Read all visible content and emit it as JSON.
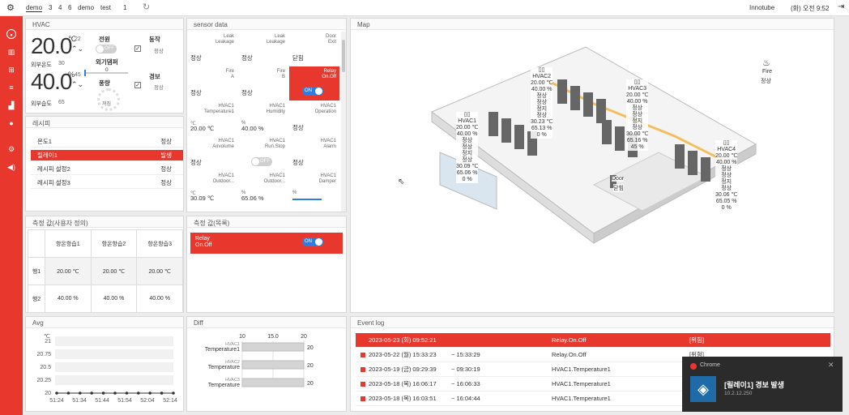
{
  "header": {
    "tabs": [
      "demo",
      "3",
      "4",
      "6",
      "demo",
      "test",
      "1"
    ],
    "brand": "Innotube",
    "clock": "(화) 오전 9:52"
  },
  "hvac": {
    "title": "HVAC",
    "temp": "20.0",
    "temp_unit": "℃",
    "temp_set": "22",
    "outdoor_temp_label": "외부온도",
    "outdoor_temp": "30",
    "humid": "40.0",
    "humid_unit": "%",
    "humid_set": "45",
    "outdoor_humid_label": "외부습도",
    "outdoor_humid": "65",
    "power_label": "전원",
    "power_state": "OFF",
    "run_label": "동작",
    "run_value": "정상",
    "damper_label": "외기댐퍼",
    "damper_value": "0",
    "airflow_label": "풍량",
    "airflow_value": "꺼짐",
    "alarm_label": "경보",
    "alarm_value": "정상"
  },
  "recipe": {
    "title": "레시피",
    "items": [
      {
        "name": "온도1",
        "status": "정상",
        "active": false
      },
      {
        "name": "릴레이1",
        "status": "발생",
        "active": true
      },
      {
        "name": "레시피 설정2",
        "status": "정상",
        "active": false
      },
      {
        "name": "레시피 설정3",
        "status": "정상",
        "active": false
      }
    ]
  },
  "sensor": {
    "title": "sensor data",
    "cells": [
      {
        "t1": "Leak",
        "t2": "Leakage",
        "v": "정상"
      },
      {
        "t1": "Leak",
        "t2": "Leakage",
        "v": "정상"
      },
      {
        "t1": "Door",
        "t2": "Exit",
        "v": "닫힘"
      },
      {
        "t1": "Fire",
        "t2": "A",
        "v": "정상"
      },
      {
        "t1": "Fire",
        "t2": "B",
        "v": "정상"
      },
      {
        "t1": "Relay",
        "t2": "On.Off",
        "v": "ON",
        "red": true
      },
      {
        "t1": "HVAC1",
        "t2": "Temperature1",
        "v": "20.00 ℃",
        "unit": "℃"
      },
      {
        "t1": "HVAC1",
        "t2": "Humidity",
        "v": "40.00 %",
        "unit": "%"
      },
      {
        "t1": "HVAC1",
        "t2": "Operation",
        "v": "정상"
      },
      {
        "t1": "HVAC1",
        "t2": "Airvolume",
        "v": "정상"
      },
      {
        "t1": "HVAC1",
        "t2": "Run.Stop",
        "v": "OFF"
      },
      {
        "t1": "HVAC1",
        "t2": "Alarm",
        "v": "정상"
      },
      {
        "t1": "HVAC1",
        "t2": "Outdoor...",
        "v": "30.09 ℃",
        "unit": "℃"
      },
      {
        "t1": "HVAC1",
        "t2": "Outdoor...",
        "v": "65.06 %",
        "unit": "%"
      },
      {
        "t1": "HVAC1",
        "t2": "Damper",
        "v": "",
        "unit": "%"
      }
    ]
  },
  "measure_def": {
    "title": "측정 값(사용자 정의)",
    "cols": [
      "항온항습1",
      "항온항습2",
      "항온항습3"
    ],
    "rows": [
      {
        "name": "행1",
        "vals": [
          "20.00 ℃",
          "20.00 ℃",
          "20.00 ℃"
        ]
      },
      {
        "name": "행2",
        "vals": [
          "40.00 %",
          "40.00 %",
          "40.00 %"
        ]
      }
    ]
  },
  "measure_list": {
    "title": "측정 값(목록)",
    "item_label": "Relay\nOn.Off",
    "item_value": "ON"
  },
  "map": {
    "title": "Map",
    "fire": {
      "label": "Fire",
      "value": "정상"
    },
    "door": {
      "label": "Door",
      "value": "닫힘"
    },
    "hvacs": [
      {
        "name": "HVAC1",
        "lines": [
          "20.00 ℃",
          "40.00 %",
          "정상",
          "정상",
          "정지",
          "정상",
          "30.09 ℃",
          "65.06 %",
          "0 %"
        ]
      },
      {
        "name": "HVAC2",
        "lines": [
          "20.00 ℃",
          "40.00 %",
          "정상",
          "정상",
          "정지",
          "정상",
          "30.23 ℃",
          "65.13 %",
          "0 %"
        ]
      },
      {
        "name": "HVAC3",
        "lines": [
          "20.00 ℃",
          "40.00 %",
          "정상",
          "정상",
          "정지",
          "정상",
          "30.00 ℃",
          "65.16 %",
          "45 %"
        ]
      },
      {
        "name": "HVAC4",
        "lines": [
          "20.00 ℃",
          "40.00 %",
          "정상",
          "정상",
          "정지",
          "정상",
          "30.06 ℃",
          "65.05 %",
          "0 %"
        ]
      }
    ]
  },
  "avg": {
    "title": "Avg",
    "unit": "℃",
    "yticks": [
      "21",
      "20.75",
      "20.5",
      "20.25",
      "20"
    ],
    "xticks": [
      "51:24",
      "51:34",
      "51:44",
      "51:54",
      "52:04",
      "52:14"
    ],
    "values": [
      20,
      20,
      20,
      20,
      20,
      20,
      20,
      20,
      20,
      20,
      20
    ]
  },
  "diff": {
    "title": "Diff",
    "xticks": [
      "10",
      "15.0",
      "20"
    ],
    "bars": [
      {
        "l1": "HVAC1",
        "l2": "Temperature1",
        "v": 20
      },
      {
        "l1": "HVAC2",
        "l2": "Temperature",
        "v": 20
      },
      {
        "l1": "HVAC3",
        "l2": "Temperature",
        "v": 20
      }
    ]
  },
  "eventlog": {
    "title": "Event log",
    "events": [
      {
        "time": "2023-05-23 (화) 09:52:21",
        "range": "",
        "name": "Relay.On.Off",
        "level": "[위험]",
        "active": true
      },
      {
        "time": "2023-05-22 (월) 15:33:23",
        "range": "~  15:33:29",
        "name": "Relay.On.Off",
        "level": "[위험]",
        "active": false
      },
      {
        "time": "2023-05-19 (금) 09:29:39",
        "range": "~  09:30:19",
        "name": "HVAC1.Temperature1",
        "level": "",
        "active": false
      },
      {
        "time": "2023-05-18 (목) 16:06:17",
        "range": "~  16:06:33",
        "name": "HVAC1.Temperature1",
        "level": "",
        "active": false
      },
      {
        "time": "2023-05-18 (목) 16:03:51",
        "range": "~  16:04:44",
        "name": "HVAC1.Temperature1",
        "level": "",
        "active": false
      }
    ]
  },
  "toast": {
    "app": "Chrome",
    "title": "[릴레이1] 경보 발생",
    "sub": "10.2.12.250"
  },
  "colors": {
    "accent": "#e8382e",
    "toggle_on": "#2f7de1"
  }
}
